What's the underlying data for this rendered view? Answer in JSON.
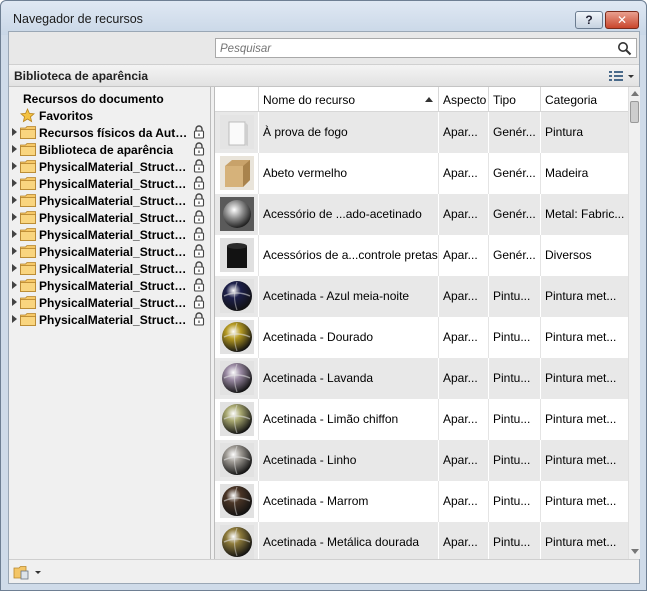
{
  "window": {
    "title": "Navegador de recursos",
    "help_label": "?",
    "close_label": "✕"
  },
  "search": {
    "placeholder": "Pesquisar"
  },
  "library": {
    "title": "Biblioteca de aparência"
  },
  "tree": {
    "root_label": "Recursos do documento",
    "favorites_label": "Favoritos",
    "items": [
      {
        "label": "Recursos físicos da Auto...",
        "locked": true
      },
      {
        "label": "Biblioteca de aparência",
        "locked": true
      },
      {
        "label": "PhysicalMaterial_Structu...",
        "locked": true
      },
      {
        "label": "PhysicalMaterial_Structu...",
        "locked": true
      },
      {
        "label": "PhysicalMaterial_Structu...",
        "locked": true
      },
      {
        "label": "PhysicalMaterial_Structu...",
        "locked": true
      },
      {
        "label": "PhysicalMaterial_Structu...",
        "locked": true
      },
      {
        "label": "PhysicalMaterial_Structu...",
        "locked": true
      },
      {
        "label": "PhysicalMaterial_Structu...",
        "locked": true
      },
      {
        "label": "PhysicalMaterial_Structu...",
        "locked": true
      },
      {
        "label": "PhysicalMaterial_Structu...",
        "locked": true
      },
      {
        "label": "PhysicalMaterial_Structu...",
        "locked": true
      }
    ]
  },
  "grid": {
    "columns": [
      "Nome do recurso",
      "Aspecto",
      "Tipo",
      "Categoria"
    ],
    "sort_column": "Nome do recurso",
    "rows": [
      {
        "name": "À prova de fogo",
        "aspect": "Apar...",
        "type": "Genér...",
        "category": "Pintura",
        "thumb": "white-block"
      },
      {
        "name": "Abeto vermelho",
        "aspect": "Apar...",
        "type": "Genér...",
        "category": "Madeira",
        "thumb": "wood-cube"
      },
      {
        "name": "Acessório de ...ado-acetinado",
        "aspect": "Apar...",
        "type": "Genér...",
        "category": "Metal: Fabric...",
        "thumb": "chrome-sphere"
      },
      {
        "name": "Acessórios de a...controle pretas",
        "aspect": "Apar...",
        "type": "Genér...",
        "category": "Diversos",
        "thumb": "black-cylinder"
      },
      {
        "name": "Acetinada - Azul meia-noite",
        "aspect": "Apar...",
        "type": "Pintu...",
        "category": "Pintura met...",
        "thumb": "sphere",
        "color": "#1c1f4a"
      },
      {
        "name": "Acetinada - Dourado",
        "aspect": "Apar...",
        "type": "Pintu...",
        "category": "Pintura met...",
        "thumb": "sphere",
        "color": "#b59a22"
      },
      {
        "name": "Acetinada - Lavanda",
        "aspect": "Apar...",
        "type": "Pintu...",
        "category": "Pintura met...",
        "thumb": "sphere",
        "color": "#9a8aa3"
      },
      {
        "name": "Acetinada - Limão chiffon",
        "aspect": "Apar...",
        "type": "Pintu...",
        "category": "Pintura met...",
        "thumb": "sphere",
        "color": "#a8a870"
      },
      {
        "name": "Acetinada - Linho",
        "aspect": "Apar...",
        "type": "Pintu...",
        "category": "Pintura met...",
        "thumb": "sphere",
        "color": "#9e9a94"
      },
      {
        "name": "Acetinada - Marrom",
        "aspect": "Apar...",
        "type": "Pintu...",
        "category": "Pintura met...",
        "thumb": "sphere",
        "color": "#4a3526"
      },
      {
        "name": "Acetinada - Metálica dourada",
        "aspect": "Apar...",
        "type": "Pintu...",
        "category": "Pintura met...",
        "thumb": "sphere",
        "color": "#8d7a3a"
      }
    ]
  },
  "icons": {
    "search": "magnifier-icon",
    "view": "list-view-icon",
    "lock": "lock-icon",
    "folder": "folder-icon",
    "star": "star-icon",
    "footer": "library-folder-icon"
  }
}
